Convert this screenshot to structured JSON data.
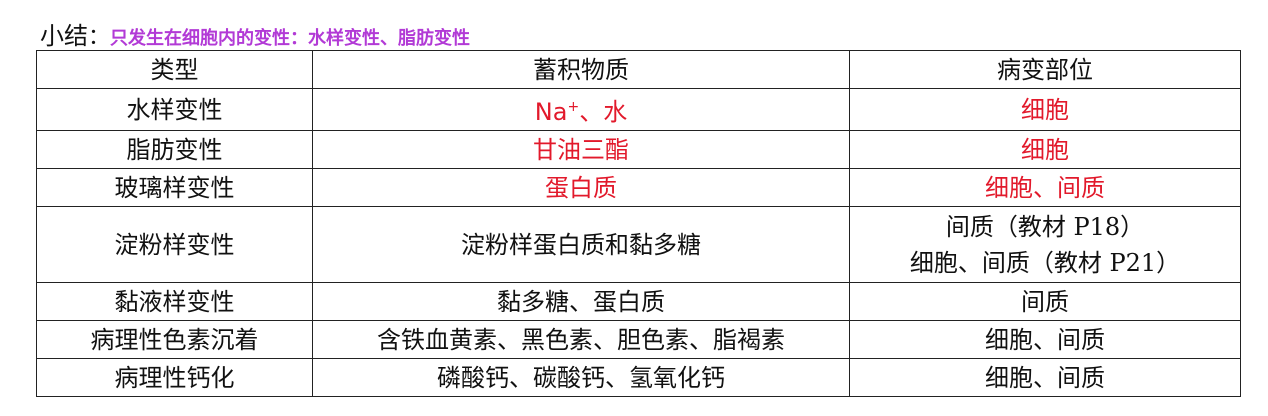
{
  "heading": {
    "lead": "小结",
    "colon": "：",
    "highlight": "只发生在细胞内的变性：水样变性、脂肪变性"
  },
  "table": {
    "headers": [
      "类型",
      "蓄积物质",
      "病变部位"
    ],
    "rows": [
      {
        "type": "水样变性",
        "substance_base": "Na",
        "substance_sup": "+",
        "substance_rest": "、水",
        "site": "细胞"
      },
      {
        "type": "脂肪变性",
        "substance": "甘油三酯",
        "site": "细胞"
      },
      {
        "type": "玻璃样变性",
        "substance": "蛋白质",
        "site": "细胞、间质"
      },
      {
        "type": "淀粉样变性",
        "substance": "淀粉样蛋白质和黏多糖",
        "site_lines": [
          "间质（教材 P18）",
          "细胞、间质（教材 P21）"
        ]
      },
      {
        "type": "黏液样变性",
        "substance": "黏多糖、蛋白质",
        "site": "间质"
      },
      {
        "type": "病理性色素沉着",
        "substance": "含铁血黄素、黑色素、胆色素、脂褐素",
        "site": "细胞、间质"
      },
      {
        "type": "病理性钙化",
        "substance": "磷酸钙、碳酸钙、氢氧化钙",
        "site": "细胞、间质"
      }
    ]
  }
}
